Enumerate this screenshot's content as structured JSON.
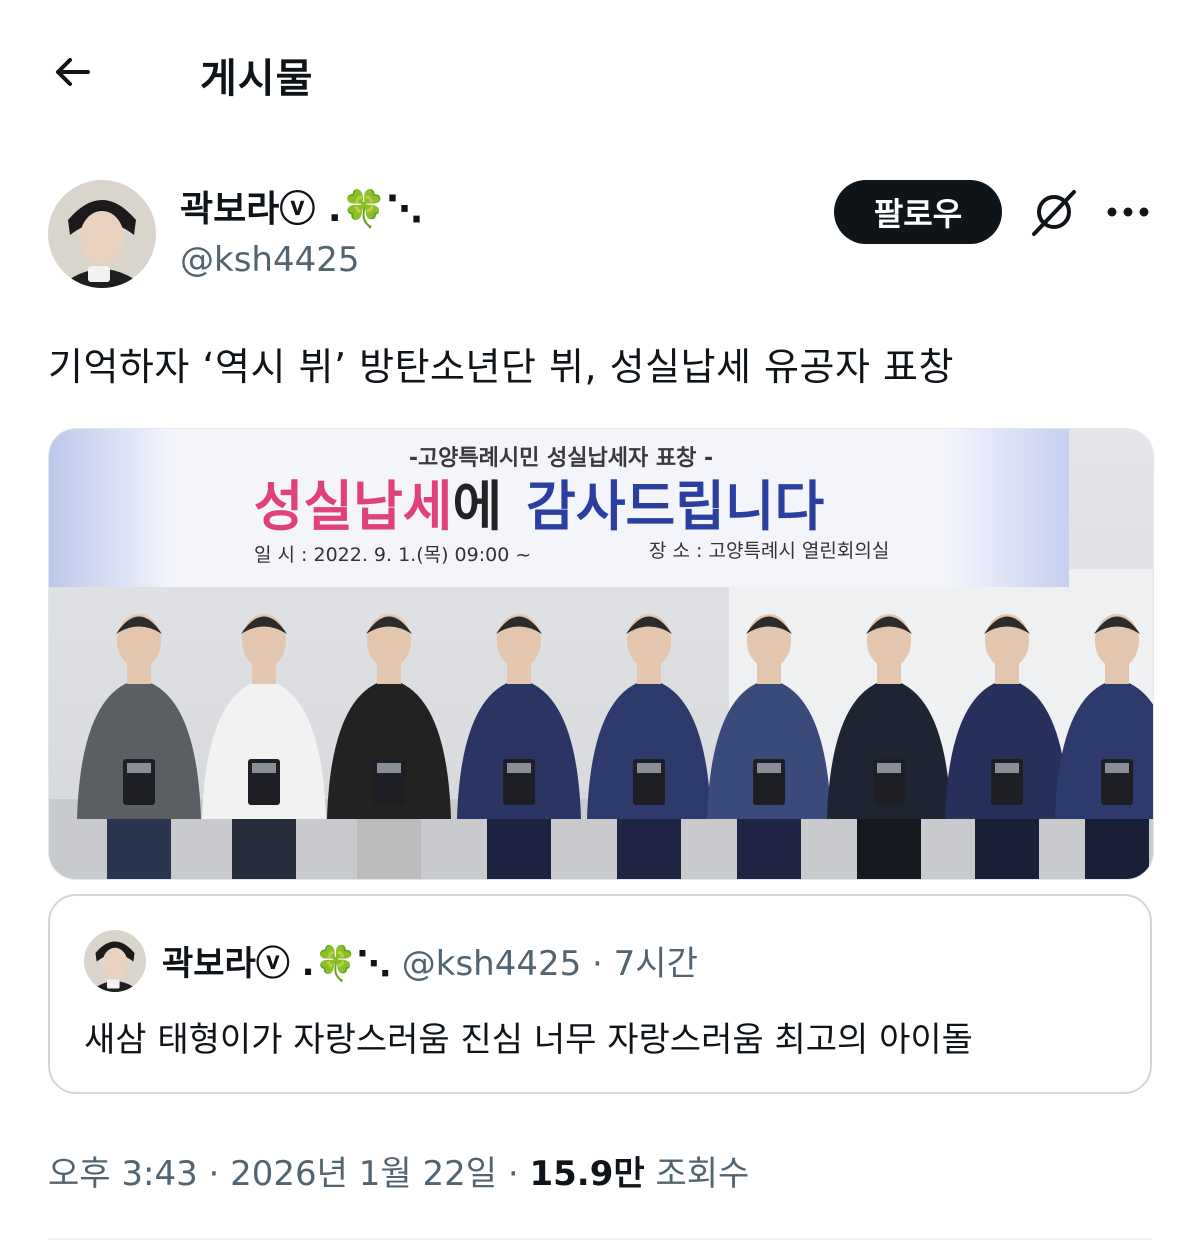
{
  "header": {
    "title": "게시물"
  },
  "author": {
    "name": "곽보라ⓥ .🍀⋱",
    "handle": "@ksh4425",
    "follow_label": "팔로우"
  },
  "tweet": {
    "text": "기억하자 ‘역시 뷔’ 방탄소년단 뷔, 성실납세 유공자 표창"
  },
  "media": {
    "banner": {
      "subtitle": "-고양특례시민 성실납세자 표창 -",
      "headline_pink": "성실납세",
      "headline_black": "에",
      "headline_blue": "감사드립니다",
      "date_line": "일 시 : 2022. 9. 1.(목) 09:00 ~",
      "place_line": "장 소 : 고양특례시 열린회의실"
    }
  },
  "quote": {
    "name": "곽보라ⓥ .🍀⋱",
    "handle": "@ksh4425",
    "separator": "·",
    "time": "7시간",
    "text": "새삼 태형이가 자랑스러움 진심 너무 자랑스러움 최고의 아이돌"
  },
  "footer": {
    "time": "오후 3:43",
    "sep1": "·",
    "date": "2026년 1월 22일",
    "sep2": "·",
    "views": "15.9만",
    "views_label": "조회수"
  },
  "colors": {
    "text": "#0f1419",
    "muted": "#536471",
    "pink": "#e0417d",
    "blue": "#2c3e9e"
  },
  "icons": [
    "back-arrow-icon",
    "grok-icon",
    "more-icon"
  ]
}
